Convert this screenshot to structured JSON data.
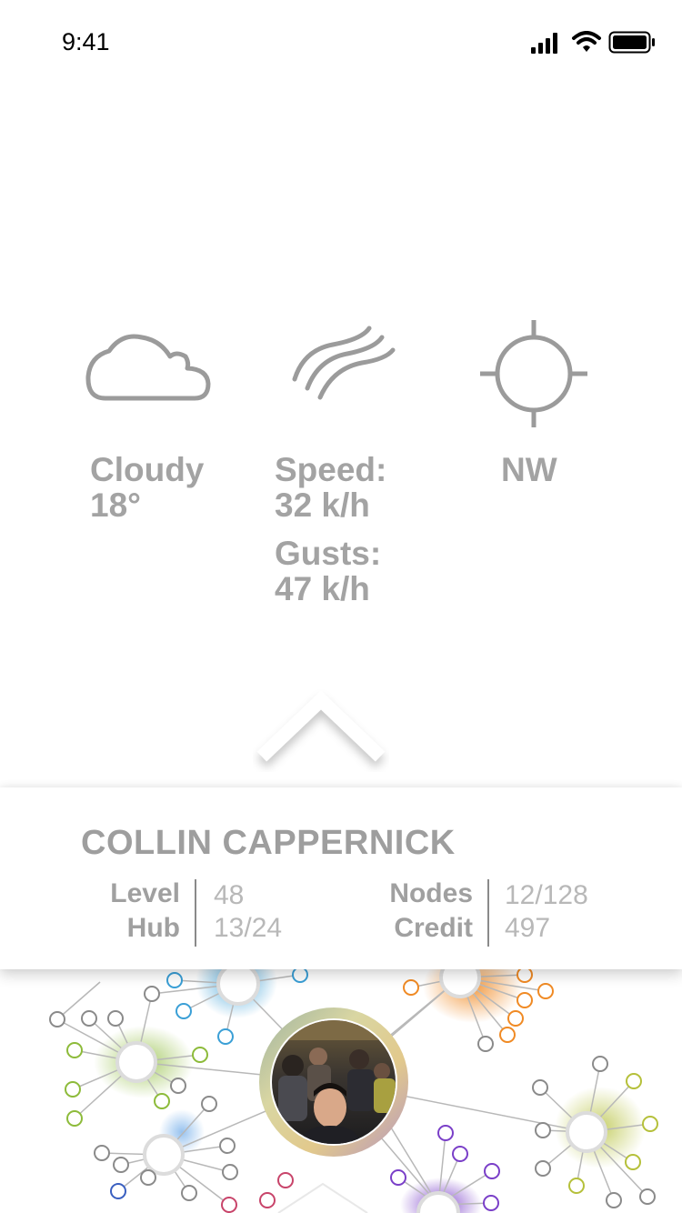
{
  "status_bar": {
    "time": "9:41"
  },
  "weather": {
    "condition": "Cloudy",
    "temperature": "18°",
    "speed_label": "Speed:",
    "speed_value": "32 k/h",
    "gusts_label": "Gusts:",
    "gusts_value": "47 k/h",
    "direction": "NW"
  },
  "profile": {
    "name": "COLLIN CAPPERNICK",
    "level_label": "Level",
    "level_value": "48",
    "hub_label": "Hub",
    "hub_value": "13/24",
    "nodes_label": "Nodes",
    "nodes_value": "12/128",
    "credit_label": "Credit",
    "credit_value": "497"
  },
  "colors": {
    "label_gray": "#a3a3a3",
    "value_gray": "#b8b8b8",
    "hub_green": "#8dbb3a",
    "hub_blue": "#3a9fd6",
    "hub_orange": "#f08a24",
    "hub_purple": "#7a3fc8",
    "hub_olive": "#b5c03a"
  },
  "icons": [
    "cloud-icon",
    "wind-icon",
    "crosshair-icon",
    "chevron-up-icon",
    "signal-icon",
    "wifi-icon",
    "battery-icon"
  ]
}
